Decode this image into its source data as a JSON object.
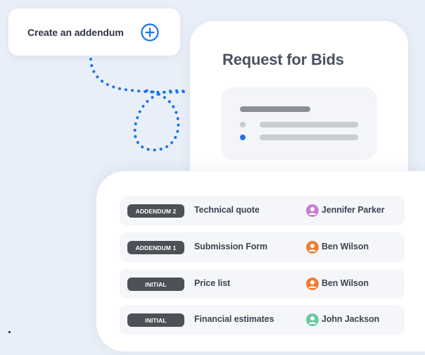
{
  "addendum_button": {
    "label": "Create an addendum",
    "icon": "plus-circle-icon",
    "accent": "#1a73e8"
  },
  "request_card": {
    "title": "Request for Bids"
  },
  "addenda": [
    {
      "badge": "ADDENDUM 2",
      "document": "Technical quote",
      "person": "Jennifer Parker",
      "avatar_color": "#c77fd0"
    },
    {
      "badge": "ADDENDUM 1",
      "document": "Submission Form",
      "person": "Ben Wilson",
      "avatar_color": "#ee7d32"
    },
    {
      "badge": "INITIAL",
      "document": "Price list",
      "person": "Ben Wilson",
      "avatar_color": "#ee7d32"
    },
    {
      "badge": "INITIAL",
      "document": "Financial estimates",
      "person": "John Jackson",
      "avatar_color": "#6dc7a1"
    }
  ],
  "colors": {
    "background": "#e9eff8",
    "badge": "#4d5057",
    "accent": "#1a73e8"
  }
}
